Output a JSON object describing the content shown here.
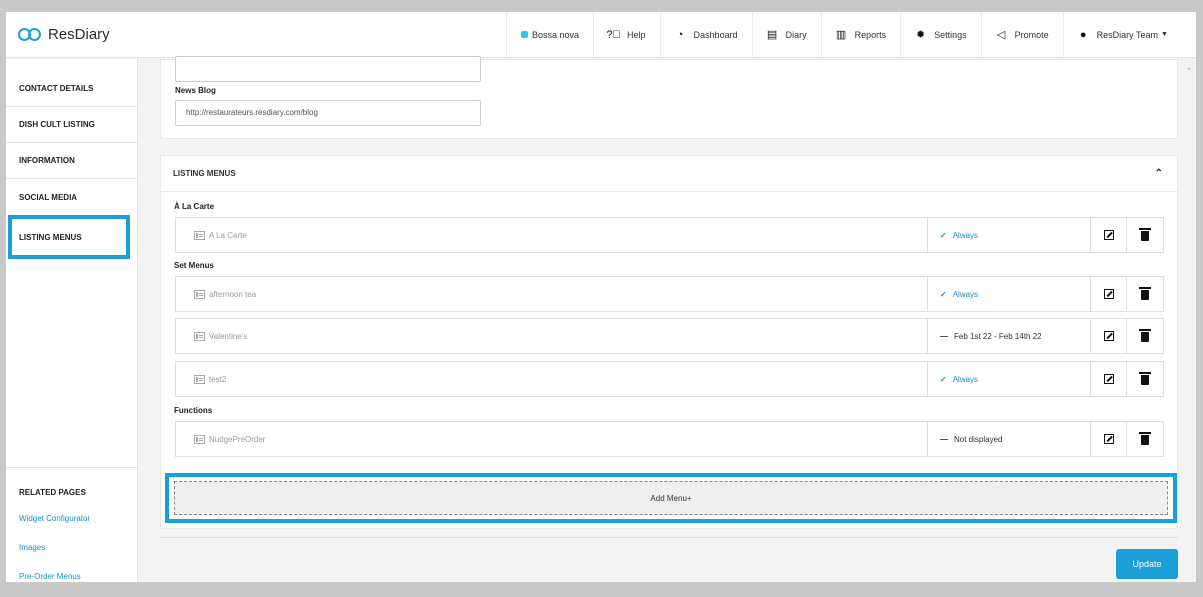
{
  "app": {
    "logo_text": "ResDiary"
  },
  "topnav": {
    "restaurant": "Bossa nova",
    "items": [
      {
        "label": "Help",
        "icon": "help-icon"
      },
      {
        "label": "Dashboard",
        "icon": "dashboard-icon"
      },
      {
        "label": "Diary",
        "icon": "diary-icon"
      },
      {
        "label": "Reports",
        "icon": "reports-icon"
      },
      {
        "label": "Settings",
        "icon": "gear-icon"
      },
      {
        "label": "Promote",
        "icon": "megaphone-icon"
      }
    ],
    "user": "ResDiary Team"
  },
  "sidebar": {
    "items": [
      {
        "label": "CONTACT DETAILS"
      },
      {
        "label": "DISH CULT LISTING"
      },
      {
        "label": "INFORMATION"
      },
      {
        "label": "SOCIAL MEDIA"
      },
      {
        "label": "LISTING MENUS"
      }
    ],
    "related_title": "RELATED PAGES",
    "related_links": [
      "Widget Configurator",
      "Images",
      "Pre-Order Menus"
    ]
  },
  "form": {
    "news_blog_label": "News Blog",
    "news_blog_value": "http://restaurateurs.resdiary.com/blog",
    "top_input_value": ""
  },
  "listing_menus": {
    "title": "LISTING MENUS",
    "groups": [
      {
        "label": "À La Carte"
      },
      {
        "label": "Set Menus"
      },
      {
        "label": "Functions"
      }
    ],
    "rows": [
      {
        "name": "A La Carte",
        "status": "Always",
        "status_type": "always"
      },
      {
        "name": "afternoon tea",
        "status": "Always",
        "status_type": "always"
      },
      {
        "name": "Valentine's",
        "status": "Feb 1st 22 - Feb 14th 22",
        "status_type": "range"
      },
      {
        "name": "test2",
        "status": "Always",
        "status_type": "always"
      },
      {
        "name": "NudgePreOrder",
        "status": "Not displayed",
        "status_type": "hidden"
      }
    ],
    "add_label": "Add Menu+"
  },
  "footer": {
    "update_label": "Update"
  },
  "colors": {
    "accent": "#1aa0d8",
    "link": "#1a8fc9",
    "status_dot": "#29c4e8"
  }
}
